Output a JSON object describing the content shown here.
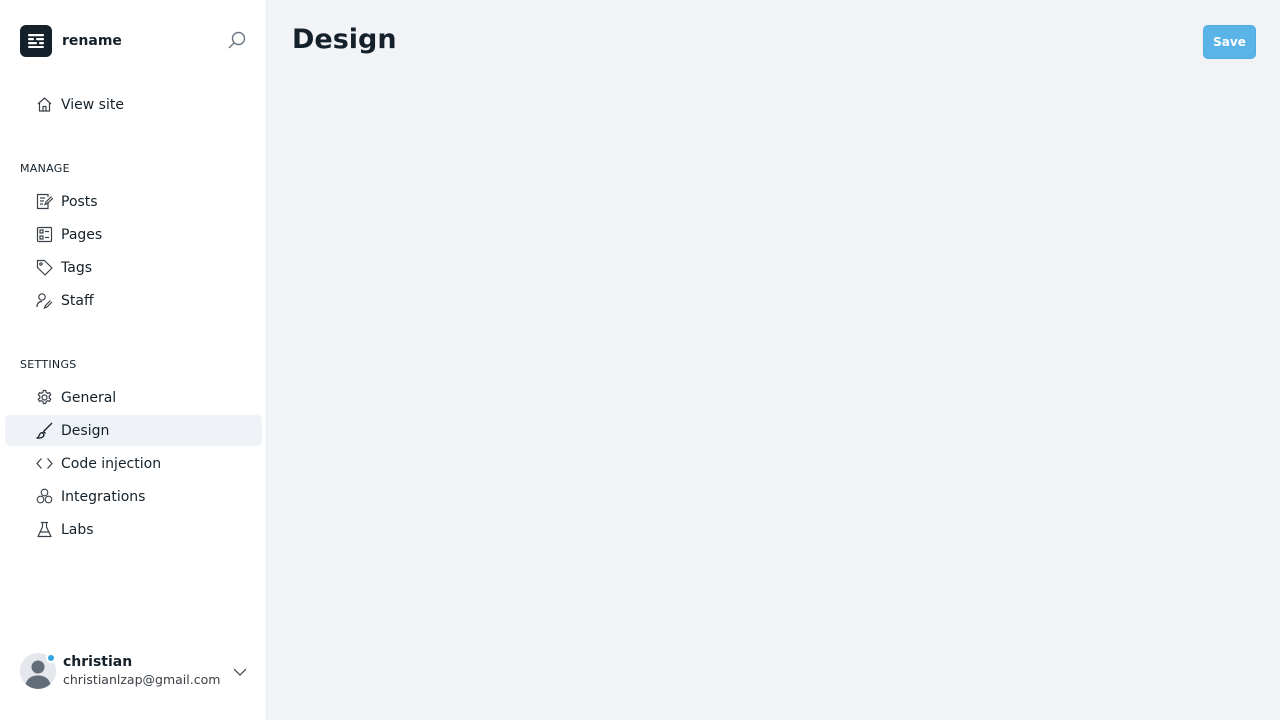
{
  "brand": {
    "name": "rename"
  },
  "nav": {
    "view_site": {
      "label": "View site",
      "icon": "home-icon"
    },
    "manage_label": "MANAGE",
    "manage_items": [
      {
        "label": "Posts",
        "icon": "posts-icon"
      },
      {
        "label": "Pages",
        "icon": "pages-icon"
      },
      {
        "label": "Tags",
        "icon": "tag-icon"
      },
      {
        "label": "Staff",
        "icon": "staff-icon"
      }
    ],
    "settings_label": "SETTINGS",
    "settings_items": [
      {
        "label": "General",
        "icon": "gear-icon"
      },
      {
        "label": "Design",
        "icon": "brush-icon",
        "active": true
      },
      {
        "label": "Code injection",
        "icon": "code-icon"
      },
      {
        "label": "Integrations",
        "icon": "integrations-icon"
      },
      {
        "label": "Labs",
        "icon": "flask-icon"
      }
    ]
  },
  "user": {
    "name": "christian",
    "email": "christianlzap@gmail.com"
  },
  "main": {
    "title": "Design",
    "save_label": "Save"
  },
  "colors": {
    "accent": "#5ab4e8",
    "sidebar_bg": "#ffffff",
    "main_bg": "#f1f3f7",
    "active_item_bg": "#eff2f6",
    "status_dot": "#30a3e0"
  }
}
